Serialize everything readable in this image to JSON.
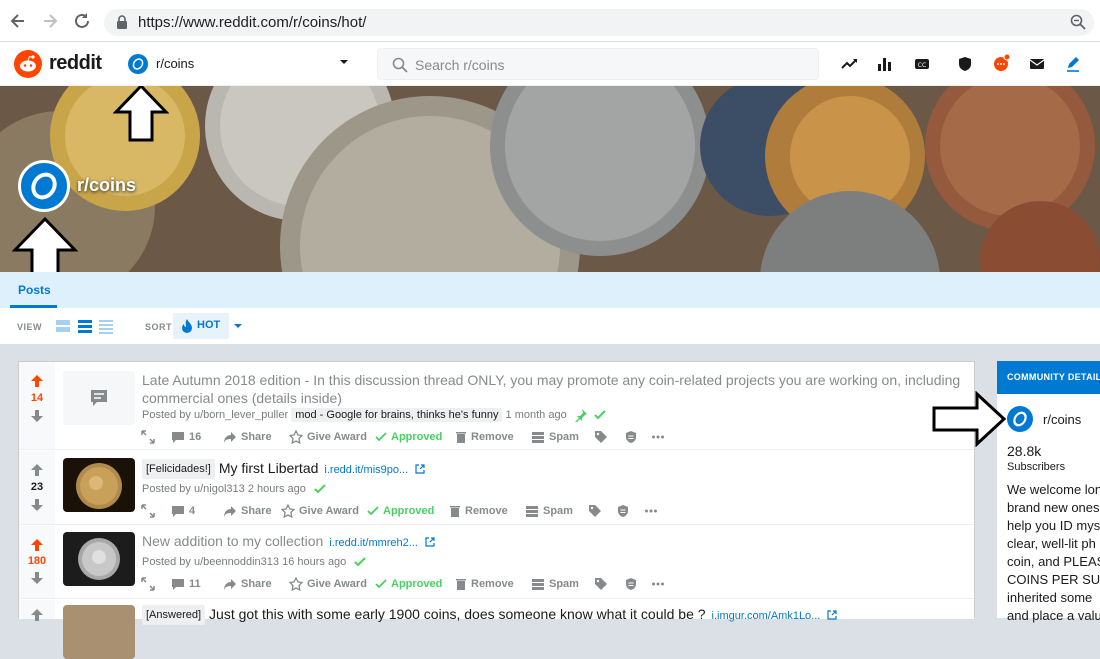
{
  "browser": {
    "url": "https://www.reddit.com/r/coins/hot/"
  },
  "header": {
    "logo_text": "reddit",
    "community": "r/coins",
    "search_placeholder": "Search r/coins"
  },
  "community": {
    "name": "r/coins",
    "tab": "Posts",
    "view_label": "VIEW",
    "sort_label": "SORT",
    "sort_value": "HOT"
  },
  "posts": [
    {
      "votes": "14",
      "title": "Late Autumn 2018 edition - In this discussion thread ONLY, you may promote any coin-related projects you are working on, including commercial ones (details inside)",
      "author": "Posted by u/born_lever_puller",
      "author_flair": "mod - Google for brains, thinks he's funny",
      "time": "1 month ago",
      "comments": "16",
      "share": "Share",
      "award": "Give Award",
      "approved": "Approved",
      "remove": "Remove",
      "spam": "Spam"
    },
    {
      "votes": "23",
      "flair": "[Felicidades!]",
      "title": "My first Libertad",
      "link": "i.redd.it/mis9po...",
      "author": "Posted by u/nigol313",
      "time": "2 hours ago",
      "comments": "4",
      "share": "Share",
      "award": "Give Award",
      "approved": "Approved",
      "remove": "Remove",
      "spam": "Spam"
    },
    {
      "votes": "180",
      "title": "New addition to my collection",
      "link": "i.redd.it/mmreh2...",
      "author": "Posted by u/beennoddin313",
      "time": "16 hours ago",
      "comments": "11",
      "share": "Share",
      "award": "Give Award",
      "approved": "Approved",
      "remove": "Remove",
      "spam": "Spam"
    },
    {
      "flair": "[Answered]",
      "title": "Just got this with some early 1900 coins, does someone know what it could be ?",
      "link": "i.imgur.com/Amk1Lo..."
    }
  ],
  "sidebar": {
    "heading": "COMMUNITY DETAILS",
    "name": "r/coins",
    "subscribers": "28.8k",
    "subscribers_label": "Subscribers",
    "description": "We welcome lon\nbrand new ones\nhelp you ID mys\nclear, well-lit ph\ncoin, and PLEAS\nCOINS PER SUB\ninherited some\nand place a valu"
  },
  "colors": {
    "upvote": "#ff4500",
    "accent": "#0079d3",
    "approved": "#46d160"
  }
}
